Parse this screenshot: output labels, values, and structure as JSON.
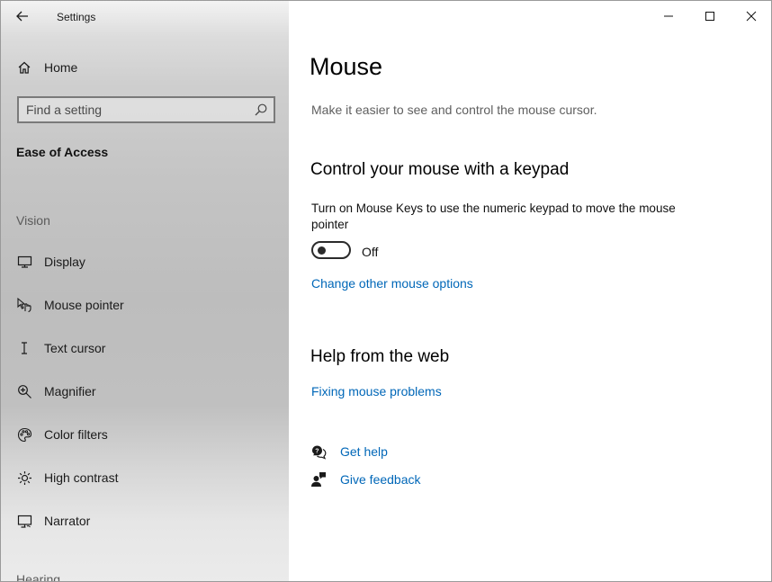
{
  "window": {
    "title": "Settings"
  },
  "sidebar": {
    "home_label": "Home",
    "search_placeholder": "Find a setting",
    "category": "Ease of Access",
    "group_vision": "Vision",
    "items": [
      {
        "label": "Display",
        "icon": "display-icon"
      },
      {
        "label": "Mouse pointer",
        "icon": "mouse-pointer-icon"
      },
      {
        "label": "Text cursor",
        "icon": "text-cursor-icon"
      },
      {
        "label": "Magnifier",
        "icon": "magnifier-icon"
      },
      {
        "label": "Color filters",
        "icon": "color-filters-icon"
      },
      {
        "label": "High contrast",
        "icon": "high-contrast-icon"
      },
      {
        "label": "Narrator",
        "icon": "narrator-icon"
      }
    ],
    "group_hearing": "Hearing"
  },
  "main": {
    "title": "Mouse",
    "subtitle": "Make it easier to see and control the mouse cursor.",
    "keypad_heading": "Control your mouse with a keypad",
    "mouse_keys_desc": "Turn on Mouse Keys to use the numeric keypad to move the mouse pointer",
    "toggle_state": "Off",
    "change_options_link": "Change other mouse options",
    "help_heading": "Help from the web",
    "fixing_link": "Fixing mouse problems",
    "get_help": "Get help",
    "give_feedback": "Give feedback"
  },
  "colors": {
    "link": "#0067b8",
    "sidebar_bg": "#c4c4c4"
  }
}
